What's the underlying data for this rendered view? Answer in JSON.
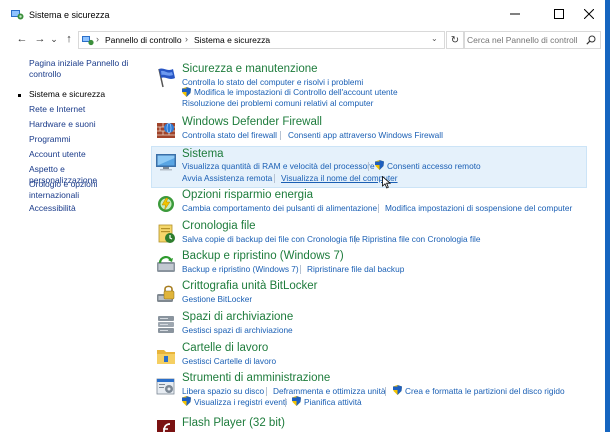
{
  "window": {
    "title": "Sistema e sicurezza",
    "minimize": "—",
    "maximize": "☐",
    "close": "✕"
  },
  "nav": {
    "back": "←",
    "forward": "→",
    "history": "⌄",
    "up": "↑",
    "breadcrumb": [
      "Pannello di controllo",
      "Sistema e sicurezza"
    ],
    "refresh": "↻",
    "search_placeholder": "Cerca nel Pannello di controllo"
  },
  "sidebar": {
    "items": [
      {
        "label": "Pagina iniziale Pannello di controllo"
      },
      {
        "label": "Sistema e sicurezza",
        "current": true
      },
      {
        "label": "Rete e Internet"
      },
      {
        "label": "Hardware e suoni"
      },
      {
        "label": "Programmi"
      },
      {
        "label": "Account utente"
      },
      {
        "label": "Aspetto e personalizzazione"
      },
      {
        "label": "Orologio e opzioni internazionali"
      },
      {
        "label": "Accessibilità"
      }
    ]
  },
  "categories": [
    {
      "title": "Sicurezza e manutenzione",
      "icon": "flag-icon",
      "links": [
        "Controlla lo stato del computer e risolvi i problemi",
        "Modifica le impostazioni di Controllo dell'account utente",
        "Risoluzione dei problemi comuni relativi al computer"
      ]
    },
    {
      "title": "Windows Defender Firewall",
      "icon": "firewall-icon",
      "links": [
        "Controlla stato del firewall",
        "Consenti app attraverso Windows Firewall"
      ]
    },
    {
      "title": "Sistema",
      "icon": "system-icon",
      "links": [
        "Visualizza quantità di RAM e velocità del processore",
        "Consenti accesso remoto",
        "Avvia Assistenza remota",
        "Visualizza il nome del computer"
      ]
    },
    {
      "title": "Opzioni risparmio energia",
      "icon": "power-icon",
      "links": [
        "Cambia comportamento dei pulsanti di alimentazione",
        "Modifica impostazioni di sospensione del computer"
      ]
    },
    {
      "title": "Cronologia file",
      "icon": "file-history-icon",
      "links": [
        "Salva copie di backup dei file con Cronologia file",
        "Ripristina file con Cronologia file"
      ]
    },
    {
      "title": "Backup e ripristino (Windows 7)",
      "icon": "backup-icon",
      "links": [
        "Backup e ripristino (Windows 7)",
        "Ripristinare file dal backup"
      ]
    },
    {
      "title": "Crittografia unità BitLocker",
      "icon": "bitlocker-icon",
      "links": [
        "Gestione BitLocker"
      ]
    },
    {
      "title": "Spazi di archiviazione",
      "icon": "storage-icon",
      "links": [
        "Gestisci spazi di archiviazione"
      ]
    },
    {
      "title": "Cartelle di lavoro",
      "icon": "folder-icon",
      "links": [
        "Gestisci Cartelle di lavoro"
      ]
    },
    {
      "title": "Strumenti di amministrazione",
      "icon": "admin-tools-icon",
      "links": [
        "Libera spazio su disco",
        "Deframmenta e ottimizza unità",
        "Crea e formatta le partizioni del disco rigido",
        "Visualizza i registri eventi",
        "Pianifica attività"
      ]
    },
    {
      "title": "Flash Player (32 bit)",
      "icon": "flash-icon",
      "links": []
    }
  ],
  "colors": {
    "link": "#1a5fb4",
    "category_title": "#1e7c3c",
    "highlight": "#e5f1fb",
    "desktop": "#1565c0"
  }
}
